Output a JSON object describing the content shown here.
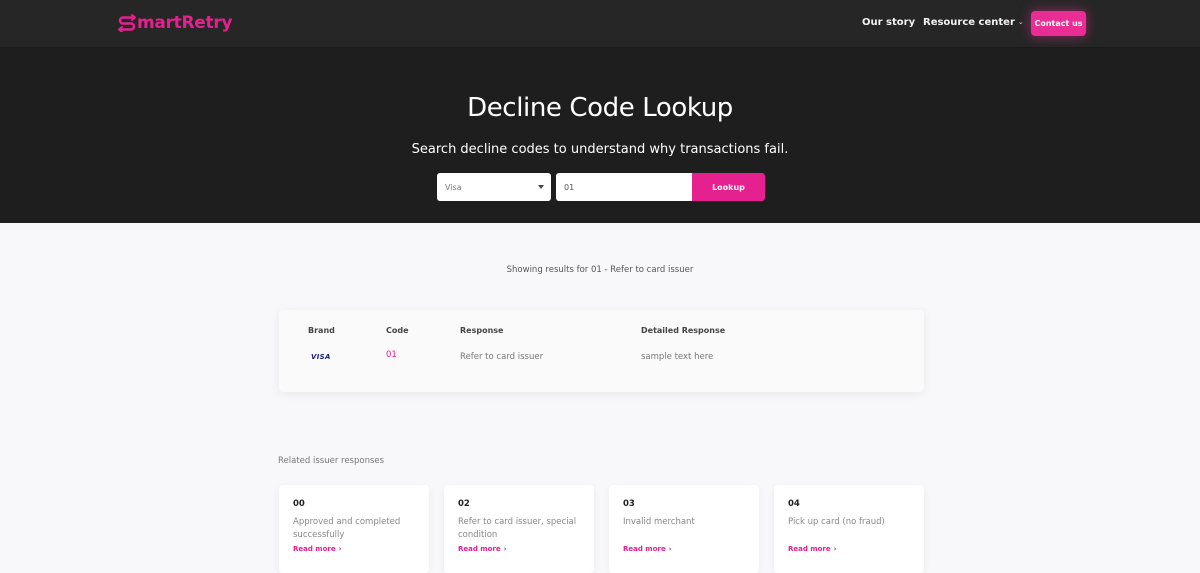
{
  "brand": {
    "name_rest": "martRetry",
    "accent": "#e5208f"
  },
  "nav": {
    "our_story": "Our story",
    "resource_center": "Resource center",
    "contact": "Contact us"
  },
  "hero": {
    "title": "Decline Code Lookup",
    "subtitle": "Search decline codes to understand why transactions fail.",
    "brand_select": "Visa",
    "code_value": "01",
    "lookup_label": "Lookup"
  },
  "results": {
    "note": "Showing results for 01 - Refer to card issuer",
    "headers": {
      "brand": "Brand",
      "code": "Code",
      "response": "Response",
      "detailed": "Detailed Response"
    },
    "row": {
      "brand_logo": "VISA",
      "code": "01",
      "response": "Refer to card issuer",
      "detailed": "sample text here"
    }
  },
  "related": {
    "title": "Related issuer responses",
    "read_more": "Read more",
    "cards": [
      {
        "code": "00",
        "desc": "Approved and completed successfully"
      },
      {
        "code": "02",
        "desc": "Refer to card issuer, special condition"
      },
      {
        "code": "03",
        "desc": "Invalid merchant"
      },
      {
        "code": "04",
        "desc": "Pick up card (no fraud)"
      }
    ]
  }
}
